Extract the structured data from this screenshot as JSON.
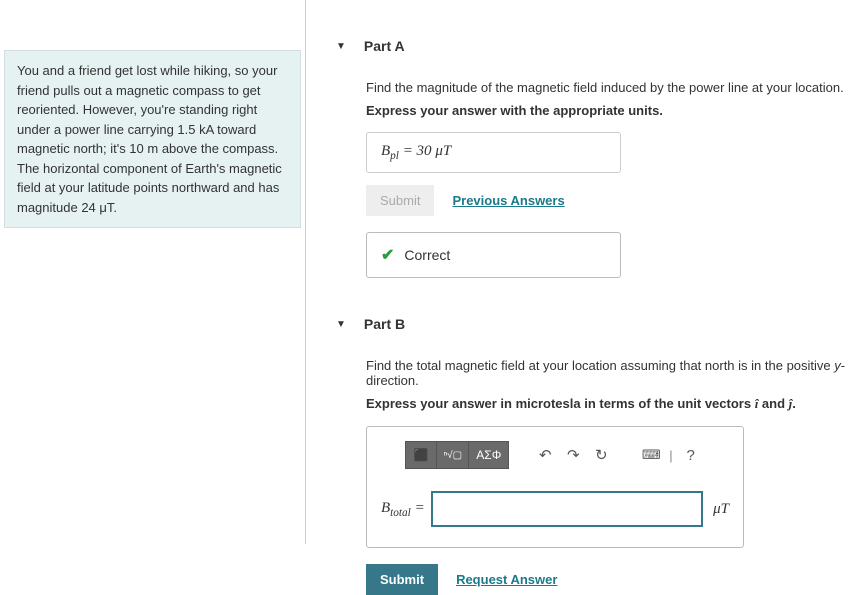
{
  "problem": {
    "text": "You and a friend get lost while hiking, so your friend pulls out a magnetic compass to get reoriented. However, you're standing right under a power line carrying 1.5 kA toward magnetic north; it's 10 m above the compass. The horizontal component of Earth's magnetic field at your latitude points northward and has magnitude 24 μT."
  },
  "partA": {
    "label": "Part A",
    "prompt": "Find the magnitude of the magnetic field induced by the power line at your location.",
    "instruction": "Express your answer with the appropriate units.",
    "answer_display": "Bₚₗ = 30 μT",
    "submit_label": "Submit",
    "prev_answers": "Previous Answers",
    "correct_label": "Correct"
  },
  "partB": {
    "label": "Part B",
    "prompt": "Find the total magnetic field at your location assuming that north is in the positive y-direction.",
    "instruction": "Express your answer in microtesla in terms of the unit vectors î and ĵ.",
    "var_label": "B_total =",
    "unit": "μT",
    "toolbar": {
      "templates": "⬛",
      "root": "ⁿ√▢",
      "greek": "ΑΣΦ",
      "undo": "↶",
      "redo": "↷",
      "reset": "↻",
      "keyboard": "⌨",
      "help": "?"
    },
    "submit_label": "Submit",
    "request_answer": "Request Answer"
  }
}
